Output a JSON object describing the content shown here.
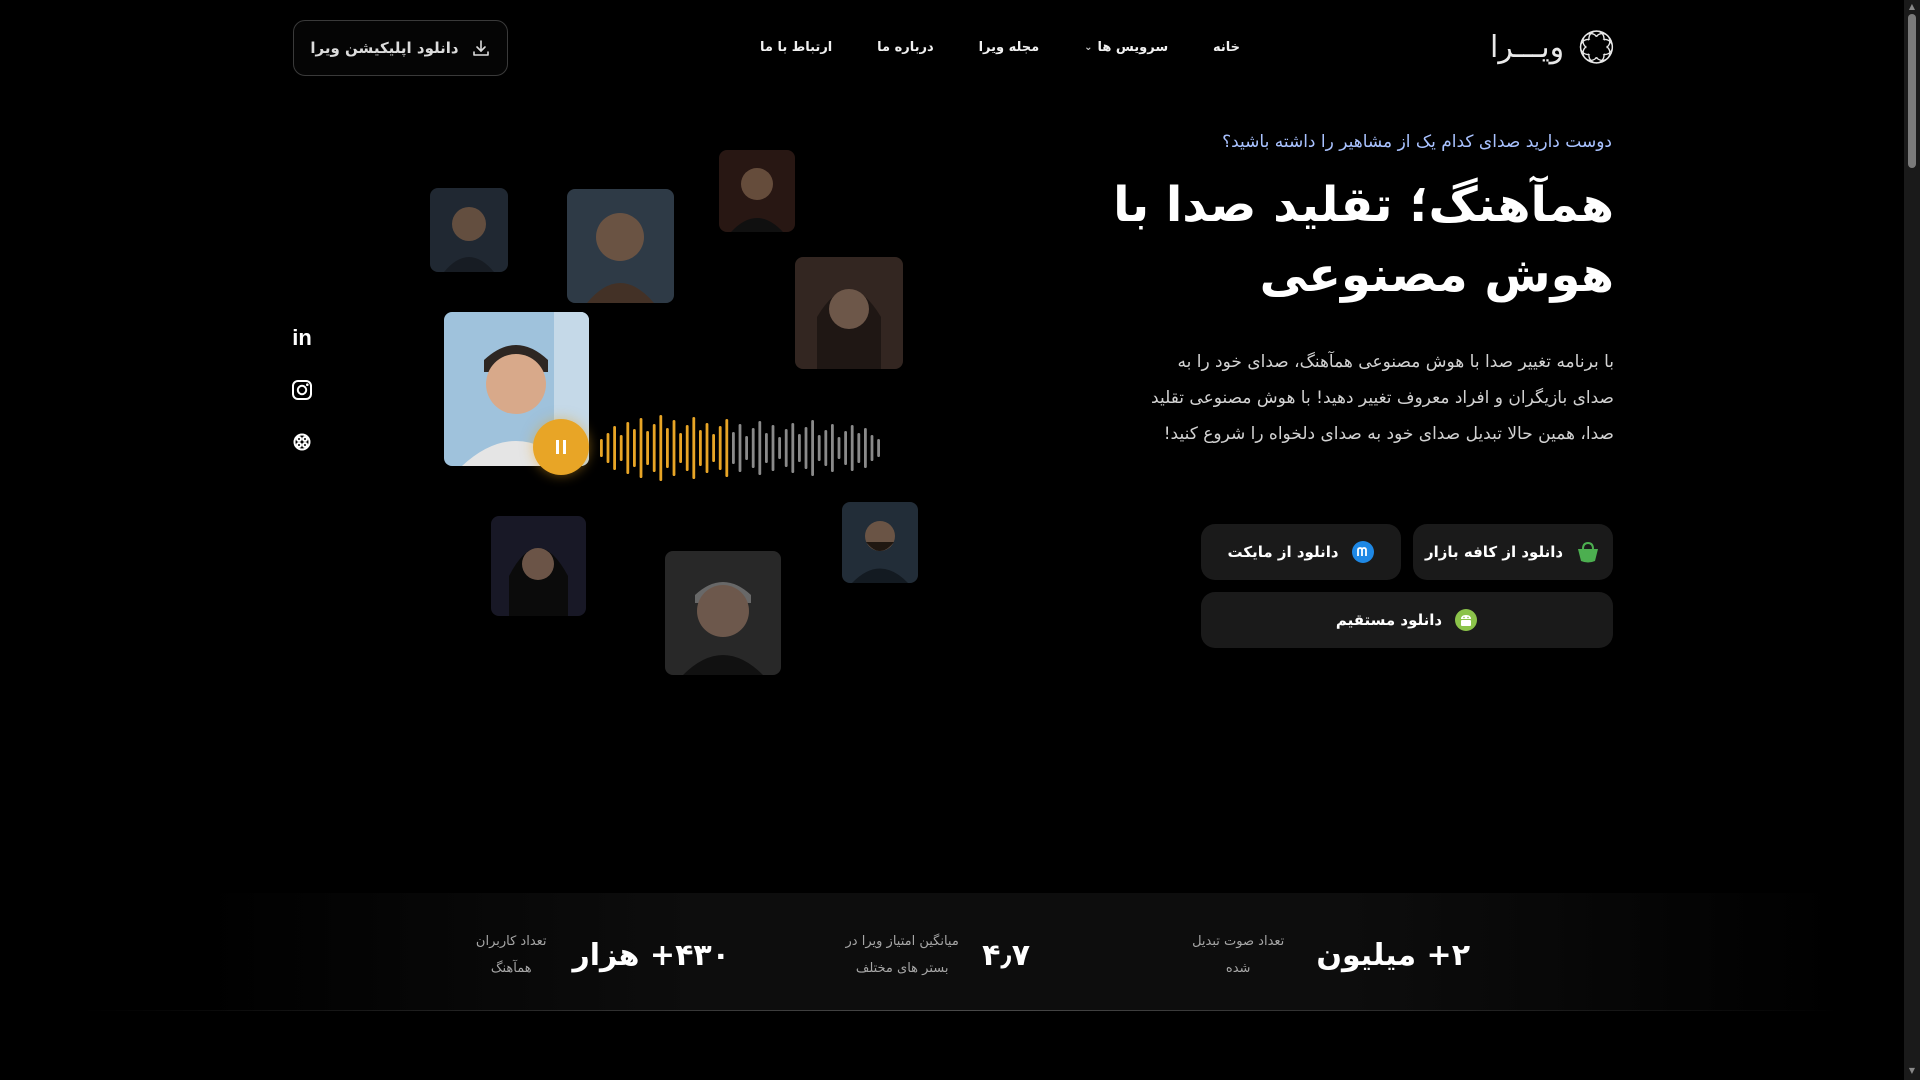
{
  "brand": {
    "logo_text": "ویـــرا"
  },
  "nav": {
    "home": "خانه",
    "services": "سرویس ها",
    "magazine": "مجله ویرا",
    "about": "درباره ما",
    "contact": "ارتباط با ما"
  },
  "header": {
    "download_app": "دانلود اپلیکیشن ویرا"
  },
  "hero": {
    "eyebrow": "دوست دارید صدای کدام یک از مشاهیر را داشته باشید؟",
    "title": "همآهنگ؛ تقلید صدا با هوش مصنوعی",
    "description": "با برنامه تغییر صدا با هوش مصنوعی همآهنگ، صدای خود را به صدای بازیگران و افراد معروف تغییر دهید! با هوش مصنوعی تقلید صدا، همین حالا تبدیل صدای خود به صدای دلخواه را شروع کنید!"
  },
  "downloads": {
    "cafe_bazaar": "دانلود از کافه بازار",
    "myket": "دانلود از مایکت",
    "direct": "دانلود مستقیم"
  },
  "social": {
    "linkedin": "in"
  },
  "stats": [
    {
      "value": "۲+ میلیون",
      "label": "تعداد صوت تبدیل شده"
    },
    {
      "value": "۴٫۷",
      "label": "میانگین امتیاز ویرا در بستر های مختلف"
    },
    {
      "value": "۴۳۰+ هزار",
      "label": "تعداد کاربران همآهنگ"
    }
  ],
  "colors": {
    "accent_orange": "#e8a526",
    "eyebrow_blue": "#a9c2ff",
    "cafe_green": "#4caf50",
    "myket_blue": "#1e88e5",
    "android_green": "#8bc34a"
  }
}
